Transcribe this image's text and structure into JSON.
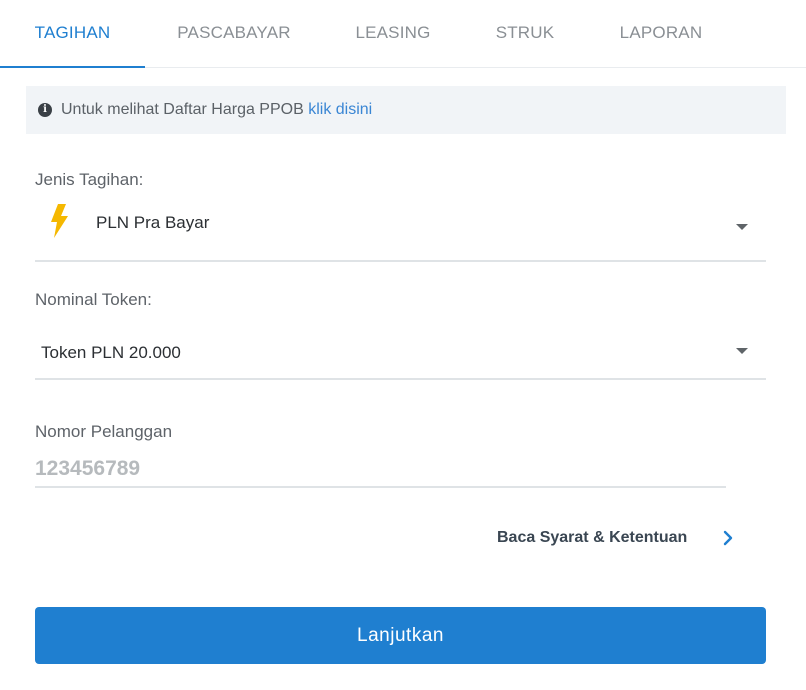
{
  "tabs": [
    {
      "label": "TAGIHAN",
      "active": true
    },
    {
      "label": "PASCABAYAR",
      "active": false
    },
    {
      "label": "LEASING",
      "active": false
    },
    {
      "label": "STRUK",
      "active": false
    },
    {
      "label": "LAPORAN",
      "active": false
    }
  ],
  "info": {
    "icon": "info-circle-icon",
    "text": "Untuk melihat Daftar Harga PPOB ",
    "link_text": "klik disini"
  },
  "form": {
    "bill_type": {
      "label": "Jenis Tagihan:",
      "value": "PLN Pra Bayar",
      "icon": "lightning-bolt-icon"
    },
    "token": {
      "label": "Nominal Token:",
      "value": "Token PLN 20.000"
    },
    "customer": {
      "label": "Nomor Pelanggan",
      "placeholder": "123456789",
      "value": ""
    }
  },
  "terms_label": "Baca Syarat & Ketentuan",
  "submit_label": "Lanjutkan",
  "colors": {
    "accent": "#1f7fd0",
    "link": "#3a86d4",
    "bolt": "#f5b800",
    "info_bg": "#f1f4f7"
  }
}
